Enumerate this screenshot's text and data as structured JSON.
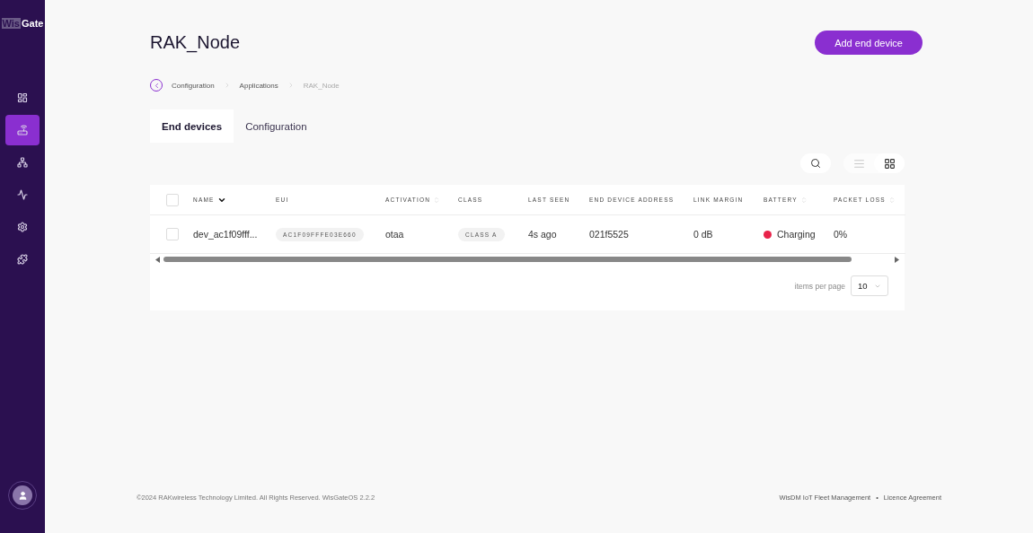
{
  "sidebar": {
    "logo_boxed": "Wis",
    "logo_text": "Gate",
    "items": [
      {
        "kind": "dashboard",
        "selected": false
      },
      {
        "kind": "devices",
        "selected": true
      },
      {
        "kind": "network",
        "selected": false
      },
      {
        "kind": "activity",
        "selected": false
      },
      {
        "kind": "settings",
        "selected": false
      },
      {
        "kind": "extensions",
        "selected": false
      }
    ]
  },
  "header": {
    "title": "RAK_Node",
    "action": "Add end device"
  },
  "breadcrumb": [
    "Configuration",
    "Applications",
    "RAK_Node"
  ],
  "tabs": [
    {
      "label": "End devices",
      "selected": true
    },
    {
      "label": "Configuration",
      "selected": false
    }
  ],
  "view_toggle": [
    {
      "kind": "list",
      "selected": false
    },
    {
      "kind": "grid",
      "selected": true
    }
  ],
  "table": {
    "select_all_checked": false,
    "columns": [
      {
        "label": "NAME",
        "sort_active": true
      },
      {
        "label": "EUI"
      },
      {
        "label": "ACTIVATION",
        "sort_active": false
      },
      {
        "label": "CLASS"
      },
      {
        "label": "LAST SEEN"
      },
      {
        "label": "END DEVICE ADDRESS"
      },
      {
        "label": "LINK MARGIN"
      },
      {
        "label": "BATTERY",
        "sort_active": false
      },
      {
        "label": "PACKET LOSS",
        "sort_active": false
      }
    ],
    "rows": [
      {
        "checked": false,
        "cells": [
          {
            "kind": "text",
            "text": "dev_ac1f09fff..."
          },
          {
            "kind": "chip",
            "text": "AC1F09FFFE03E660"
          },
          {
            "kind": "text",
            "text": "otaa"
          },
          {
            "kind": "chip",
            "text": "CLASS A"
          },
          {
            "kind": "text",
            "text": "4s ago"
          },
          {
            "kind": "text",
            "text": "021f5525"
          },
          {
            "kind": "text",
            "text": "0 dB"
          },
          {
            "kind": "status",
            "text": "Charging",
            "color": "#e8234a"
          },
          {
            "kind": "text",
            "text": "0%"
          }
        ]
      }
    ]
  },
  "pagination": {
    "label": "items per page",
    "value": "10"
  },
  "footer": {
    "copyright": "©2024 RAKwireless Technology Limited. All Rights Reserved. WisGateOS 2.2.2",
    "links": [
      "WisDM IoT Fleet Management",
      "Licence Agreement"
    ],
    "separator": "•"
  }
}
